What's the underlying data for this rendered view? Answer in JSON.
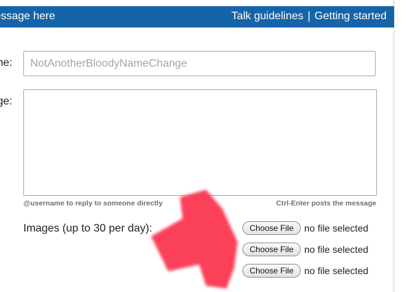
{
  "header": {
    "title": "Message here",
    "links": [
      "Talk guidelines",
      "Getting started"
    ],
    "separator": "|",
    "background": "#1564a8"
  },
  "form": {
    "name_label": "Name:",
    "name_placeholder": "NotAnotherBloodyNameChange",
    "message_label": "Message:",
    "message_value": "",
    "hint_left": "@username to reply to someone directly",
    "hint_right": "Ctrl-Enter posts the message",
    "images_label": "Images (up to 30 per day):",
    "file_inputs": [
      {
        "button": "Choose File",
        "status": "no file selected"
      },
      {
        "button": "Choose File",
        "status": "no file selected"
      },
      {
        "button": "Choose File",
        "status": "no file selected"
      }
    ]
  },
  "annotation": {
    "shape": "arrow-icon",
    "color": "#fb2f4c"
  }
}
